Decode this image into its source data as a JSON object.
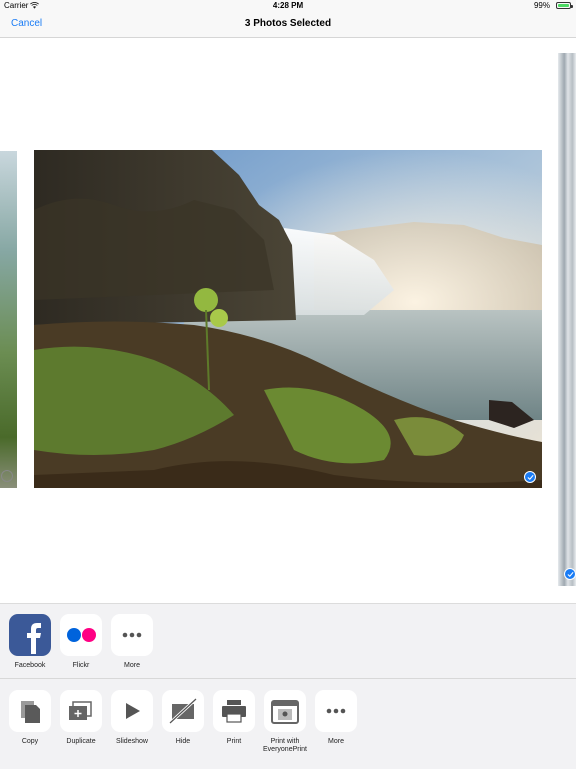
{
  "status_bar": {
    "carrier": "Carrier",
    "time": "4:28 PM",
    "battery": "99%"
  },
  "nav": {
    "cancel": "Cancel",
    "title": "3 Photos Selected"
  },
  "colors": {
    "accent": "#1a7cf5",
    "battery_green": "#4cd964",
    "facebook_blue": "#3b5998",
    "flickr_blue": "#0063dc",
    "flickr_pink": "#ff0084"
  },
  "apps": [
    {
      "label": "Facebook",
      "icon": "facebook-icon"
    },
    {
      "label": "Flickr",
      "icon": "flickr-icon"
    },
    {
      "label": "More",
      "icon": "more-icon"
    }
  ],
  "actions": [
    {
      "label": "Copy",
      "icon": "copy-icon"
    },
    {
      "label": "Duplicate",
      "icon": "duplicate-icon"
    },
    {
      "label": "Slideshow",
      "icon": "play-icon"
    },
    {
      "label": "Hide",
      "icon": "hide-icon"
    },
    {
      "label": "Print",
      "icon": "printer-icon"
    },
    {
      "label_line1": "Print with",
      "label_line2": "EveryonePrint",
      "icon": "everyoneprint-icon"
    },
    {
      "label": "More",
      "icon": "more-icon"
    }
  ]
}
